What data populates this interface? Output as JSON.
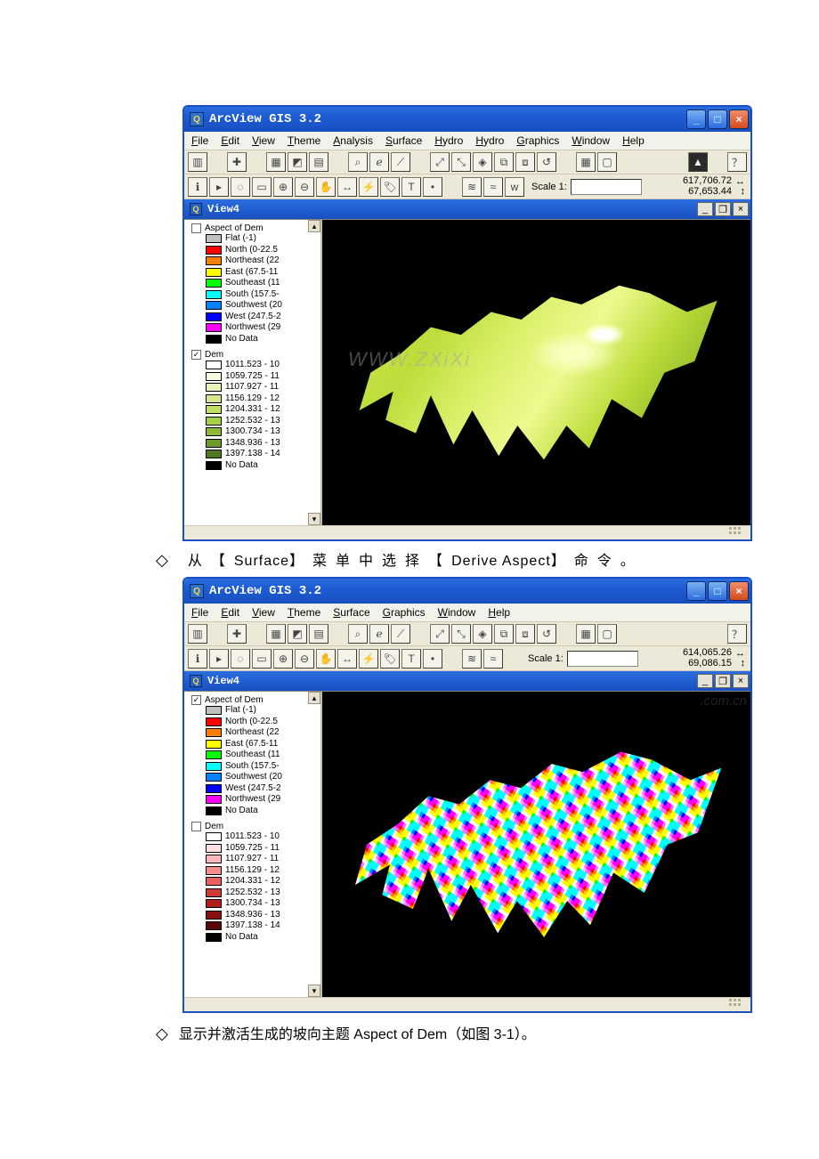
{
  "doc": {
    "bullet1_pre": "从",
    "br_l": "【",
    "br_r": "】",
    "surface": "Surface",
    "bullet1_mid": "菜单中选择",
    "derive": "Derive Aspect",
    "bullet1_end": "命令。",
    "bullet2": "显示并激活生成的坡向主题 Aspect of Dem（如图 3-1）。"
  },
  "app1": {
    "title": "ArcView GIS 3.2",
    "menus": [
      "File",
      "Edit",
      "View",
      "Theme",
      "Analysis",
      "Surface",
      "Hydro",
      "Hydro",
      "Graphics",
      "Window",
      "Help"
    ],
    "scale_label": "Scale 1:",
    "coord_x": "617,706.72",
    "coord_y": "67,653.44",
    "child_title": "View4",
    "watermark": "WWW.ZXiXi",
    "themes": [
      {
        "name": "Aspect of Dem",
        "checked": false,
        "entries": [
          {
            "c": "#c0c0c0",
            "t": "Flat (-1)"
          },
          {
            "c": "#ff0000",
            "t": "North (0-22.5"
          },
          {
            "c": "#ff8000",
            "t": "Northeast (22"
          },
          {
            "c": "#ffff00",
            "t": "East (67.5-11"
          },
          {
            "c": "#00ff00",
            "t": "Southeast (11"
          },
          {
            "c": "#00ffff",
            "t": "South (157.5-"
          },
          {
            "c": "#0080ff",
            "t": "Southwest (20"
          },
          {
            "c": "#0000ff",
            "t": "West (247.5-2"
          },
          {
            "c": "#ff00ff",
            "t": "Northwest (29"
          },
          {
            "c": "#000000",
            "t": "No Data"
          }
        ]
      },
      {
        "name": "Dem",
        "checked": true,
        "entries": [
          {
            "c": "#ffffff",
            "t": "1011.523 - 10"
          },
          {
            "c": "#f6fadf",
            "t": "1059.725 - 11"
          },
          {
            "c": "#e7f1b8",
            "t": "1107.927 - 11"
          },
          {
            "c": "#d5e98c",
            "t": "1156.129 - 12"
          },
          {
            "c": "#c2df64",
            "t": "1204.331 - 12"
          },
          {
            "c": "#a9cf47",
            "t": "1252.532 - 13"
          },
          {
            "c": "#8cb936",
            "t": "1300.734 - 13"
          },
          {
            "c": "#6e9a2a",
            "t": "1348.936 - 13"
          },
          {
            "c": "#4f7820",
            "t": "1397.138 - 14"
          },
          {
            "c": "#000000",
            "t": "No Data"
          }
        ]
      }
    ]
  },
  "app2": {
    "title": "ArcView GIS 3.2",
    "menus": [
      "File",
      "Edit",
      "View",
      "Theme",
      "Surface",
      "Graphics",
      "Window",
      "Help"
    ],
    "scale_label": "Scale 1:",
    "coord_x": "614,065.26",
    "coord_y": "69,086.15",
    "child_title": "View4",
    "watermark": ".com.cn",
    "themes": [
      {
        "name": "Aspect of Dem",
        "checked": true,
        "entries": [
          {
            "c": "#c0c0c0",
            "t": "Flat (-1)"
          },
          {
            "c": "#ff0000",
            "t": "North (0-22.5"
          },
          {
            "c": "#ff8000",
            "t": "Northeast (22"
          },
          {
            "c": "#ffff00",
            "t": "East (67.5-11"
          },
          {
            "c": "#00ff00",
            "t": "Southeast (11"
          },
          {
            "c": "#00ffff",
            "t": "South (157.5-"
          },
          {
            "c": "#0080ff",
            "t": "Southwest (20"
          },
          {
            "c": "#0000ff",
            "t": "West (247.5-2"
          },
          {
            "c": "#ff00ff",
            "t": "Northwest (29"
          },
          {
            "c": "#000000",
            "t": "No Data"
          }
        ]
      },
      {
        "name": "Dem",
        "checked": false,
        "entries": [
          {
            "c": "#ffffff",
            "t": "1011.523 - 10"
          },
          {
            "c": "#ffe0e0",
            "t": "1059.725 - 11"
          },
          {
            "c": "#ffb8b8",
            "t": "1107.927 - 11"
          },
          {
            "c": "#f58e8e",
            "t": "1156.129 - 12"
          },
          {
            "c": "#e86060",
            "t": "1204.331 - 12"
          },
          {
            "c": "#d23a3a",
            "t": "1252.532 - 13"
          },
          {
            "c": "#b01e1e",
            "t": "1300.734 - 13"
          },
          {
            "c": "#8a0f0f",
            "t": "1348.936 - 13"
          },
          {
            "c": "#5e0606",
            "t": "1397.138 - 14"
          },
          {
            "c": "#000000",
            "t": "No Data"
          }
        ]
      }
    ]
  }
}
